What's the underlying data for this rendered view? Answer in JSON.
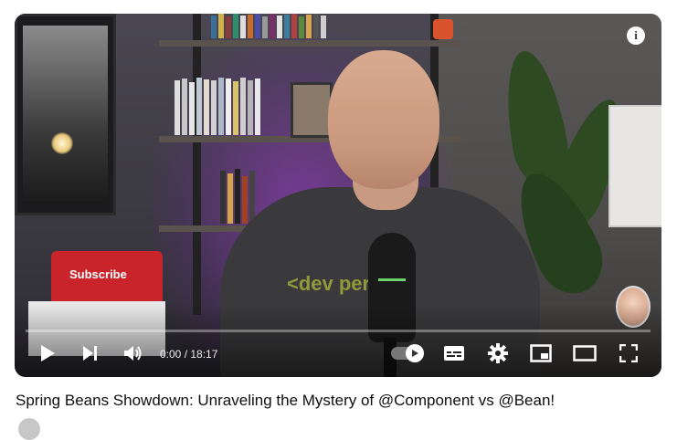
{
  "video": {
    "title": "Spring Beans Showdown: Unraveling the Mystery of @Component vs @Bean!",
    "subscribe_label": "Subscribe",
    "shirt_logo": "<dev per",
    "info_label": "i",
    "progress_fraction": 0.0
  },
  "controls": {
    "time_current": "0:00",
    "time_separator": " / ",
    "time_total": "18:17",
    "play_icon": "play-icon",
    "next_icon": "next-icon",
    "volume_icon": "volume-icon",
    "autoplay_icon": "autoplay-toggle-icon",
    "captions_icon": "captions-icon",
    "settings_icon": "gear-icon",
    "miniplayer_icon": "miniplayer-icon",
    "theater_icon": "theater-icon",
    "fullscreen_icon": "fullscreen-icon"
  },
  "colors": {
    "progress": "#ff0000",
    "subscribe_bg": "#c9242a",
    "purple_glow": "#aa3cdc"
  }
}
